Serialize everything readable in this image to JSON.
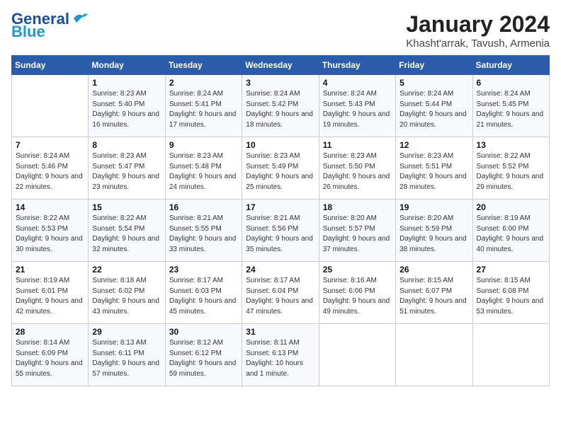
{
  "header": {
    "logo_general": "General",
    "logo_blue": "Blue",
    "month": "January 2024",
    "location": "Khasht'arrak, Tavush, Armenia"
  },
  "weekdays": [
    "Sunday",
    "Monday",
    "Tuesday",
    "Wednesday",
    "Thursday",
    "Friday",
    "Saturday"
  ],
  "weeks": [
    [
      {
        "day": "",
        "info": ""
      },
      {
        "day": "1",
        "info": "Sunrise: 8:23 AM\nSunset: 5:40 PM\nDaylight: 9 hours and 16 minutes."
      },
      {
        "day": "2",
        "info": "Sunrise: 8:24 AM\nSunset: 5:41 PM\nDaylight: 9 hours and 17 minutes."
      },
      {
        "day": "3",
        "info": "Sunrise: 8:24 AM\nSunset: 5:42 PM\nDaylight: 9 hours and 18 minutes."
      },
      {
        "day": "4",
        "info": "Sunrise: 8:24 AM\nSunset: 5:43 PM\nDaylight: 9 hours and 19 minutes."
      },
      {
        "day": "5",
        "info": "Sunrise: 8:24 AM\nSunset: 5:44 PM\nDaylight: 9 hours and 20 minutes."
      },
      {
        "day": "6",
        "info": "Sunrise: 8:24 AM\nSunset: 5:45 PM\nDaylight: 9 hours and 21 minutes."
      }
    ],
    [
      {
        "day": "7",
        "info": "Sunrise: 8:24 AM\nSunset: 5:46 PM\nDaylight: 9 hours and 22 minutes."
      },
      {
        "day": "8",
        "info": "Sunrise: 8:23 AM\nSunset: 5:47 PM\nDaylight: 9 hours and 23 minutes."
      },
      {
        "day": "9",
        "info": "Sunrise: 8:23 AM\nSunset: 5:48 PM\nDaylight: 9 hours and 24 minutes."
      },
      {
        "day": "10",
        "info": "Sunrise: 8:23 AM\nSunset: 5:49 PM\nDaylight: 9 hours and 25 minutes."
      },
      {
        "day": "11",
        "info": "Sunrise: 8:23 AM\nSunset: 5:50 PM\nDaylight: 9 hours and 26 minutes."
      },
      {
        "day": "12",
        "info": "Sunrise: 8:23 AM\nSunset: 5:51 PM\nDaylight: 9 hours and 28 minutes."
      },
      {
        "day": "13",
        "info": "Sunrise: 8:22 AM\nSunset: 5:52 PM\nDaylight: 9 hours and 29 minutes."
      }
    ],
    [
      {
        "day": "14",
        "info": "Sunrise: 8:22 AM\nSunset: 5:53 PM\nDaylight: 9 hours and 30 minutes."
      },
      {
        "day": "15",
        "info": "Sunrise: 8:22 AM\nSunset: 5:54 PM\nDaylight: 9 hours and 32 minutes."
      },
      {
        "day": "16",
        "info": "Sunrise: 8:21 AM\nSunset: 5:55 PM\nDaylight: 9 hours and 33 minutes."
      },
      {
        "day": "17",
        "info": "Sunrise: 8:21 AM\nSunset: 5:56 PM\nDaylight: 9 hours and 35 minutes."
      },
      {
        "day": "18",
        "info": "Sunrise: 8:20 AM\nSunset: 5:57 PM\nDaylight: 9 hours and 37 minutes."
      },
      {
        "day": "19",
        "info": "Sunrise: 8:20 AM\nSunset: 5:59 PM\nDaylight: 9 hours and 38 minutes."
      },
      {
        "day": "20",
        "info": "Sunrise: 8:19 AM\nSunset: 6:00 PM\nDaylight: 9 hours and 40 minutes."
      }
    ],
    [
      {
        "day": "21",
        "info": "Sunrise: 8:19 AM\nSunset: 6:01 PM\nDaylight: 9 hours and 42 minutes."
      },
      {
        "day": "22",
        "info": "Sunrise: 8:18 AM\nSunset: 6:02 PM\nDaylight: 9 hours and 43 minutes."
      },
      {
        "day": "23",
        "info": "Sunrise: 8:17 AM\nSunset: 6:03 PM\nDaylight: 9 hours and 45 minutes."
      },
      {
        "day": "24",
        "info": "Sunrise: 8:17 AM\nSunset: 6:04 PM\nDaylight: 9 hours and 47 minutes."
      },
      {
        "day": "25",
        "info": "Sunrise: 8:16 AM\nSunset: 6:06 PM\nDaylight: 9 hours and 49 minutes."
      },
      {
        "day": "26",
        "info": "Sunrise: 8:15 AM\nSunset: 6:07 PM\nDaylight: 9 hours and 51 minutes."
      },
      {
        "day": "27",
        "info": "Sunrise: 8:15 AM\nSunset: 6:08 PM\nDaylight: 9 hours and 53 minutes."
      }
    ],
    [
      {
        "day": "28",
        "info": "Sunrise: 8:14 AM\nSunset: 6:09 PM\nDaylight: 9 hours and 55 minutes."
      },
      {
        "day": "29",
        "info": "Sunrise: 8:13 AM\nSunset: 6:11 PM\nDaylight: 9 hours and 57 minutes."
      },
      {
        "day": "30",
        "info": "Sunrise: 8:12 AM\nSunset: 6:12 PM\nDaylight: 9 hours and 59 minutes."
      },
      {
        "day": "31",
        "info": "Sunrise: 8:11 AM\nSunset: 6:13 PM\nDaylight: 10 hours and 1 minute."
      },
      {
        "day": "",
        "info": ""
      },
      {
        "day": "",
        "info": ""
      },
      {
        "day": "",
        "info": ""
      }
    ]
  ]
}
